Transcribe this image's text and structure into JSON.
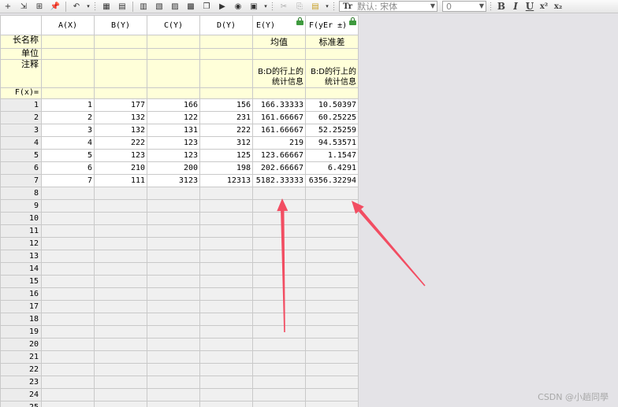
{
  "toolbar": {
    "icons": [
      "add-column-icon",
      "add-row-icon",
      "column-label-icon",
      "pin-icon",
      "undo-icon",
      "undo-dropdown-icon",
      "set-xy-icon",
      "set-values-icon",
      "sort-icon",
      "statistics-icon",
      "import-icon",
      "export-icon",
      "copy-icon",
      "paste-icon",
      "mask-icon",
      "dropdown-icon",
      "cut-icon",
      "copy-plain-icon",
      "paste-plain-icon"
    ],
    "font_name": "默认: 宋体",
    "font_size": "0",
    "format_bold": "B",
    "format_italic": "I",
    "format_underline": "U",
    "format_superscript": "x²",
    "format_subscript": "x₂"
  },
  "sheet": {
    "columns": [
      {
        "label": "A(X)"
      },
      {
        "label": "B(Y)"
      },
      {
        "label": "C(Y)"
      },
      {
        "label": "D(Y)"
      },
      {
        "label": "E(Y)",
        "locked": true
      },
      {
        "label": "F(yEr ±)",
        "locked": true
      }
    ],
    "meta_rows": {
      "long_name": {
        "header": "长名称",
        "values": [
          "",
          "",
          "",
          "",
          "均值",
          "标准差"
        ]
      },
      "units": {
        "header": "单位",
        "values": [
          "",
          "",
          "",
          "",
          "",
          ""
        ]
      },
      "comments": {
        "header": "注释",
        "values": [
          "",
          "",
          "",
          "",
          "B:D的行上的统计信息",
          "B:D的行上的统计信息"
        ]
      },
      "formula": {
        "header": "F(x)=",
        "values": [
          "",
          "",
          "",
          "",
          "",
          ""
        ]
      }
    },
    "rows": [
      [
        "1",
        "177",
        "166",
        "156",
        "166.33333",
        "10.50397"
      ],
      [
        "2",
        "132",
        "122",
        "231",
        "161.66667",
        "60.25225"
      ],
      [
        "3",
        "132",
        "131",
        "222",
        "161.66667",
        "52.25259"
      ],
      [
        "4",
        "222",
        "123",
        "312",
        "219",
        "94.53571"
      ],
      [
        "5",
        "123",
        "123",
        "125",
        "123.66667",
        "1.1547"
      ],
      [
        "6",
        "210",
        "200",
        "198",
        "202.66667",
        "6.4291"
      ],
      [
        "7",
        "111",
        "3123",
        "12313",
        "5182.33333",
        "6356.32294"
      ]
    ],
    "row_numbers": [
      "1",
      "2",
      "3",
      "4",
      "5",
      "6",
      "7",
      "8",
      "9",
      "10",
      "11",
      "12",
      "13",
      "14",
      "15",
      "16",
      "17",
      "18",
      "19",
      "20",
      "21",
      "22",
      "23",
      "24",
      "25"
    ]
  },
  "annotation_color": "#f24d62",
  "watermark": "CSDN @小趟同學"
}
